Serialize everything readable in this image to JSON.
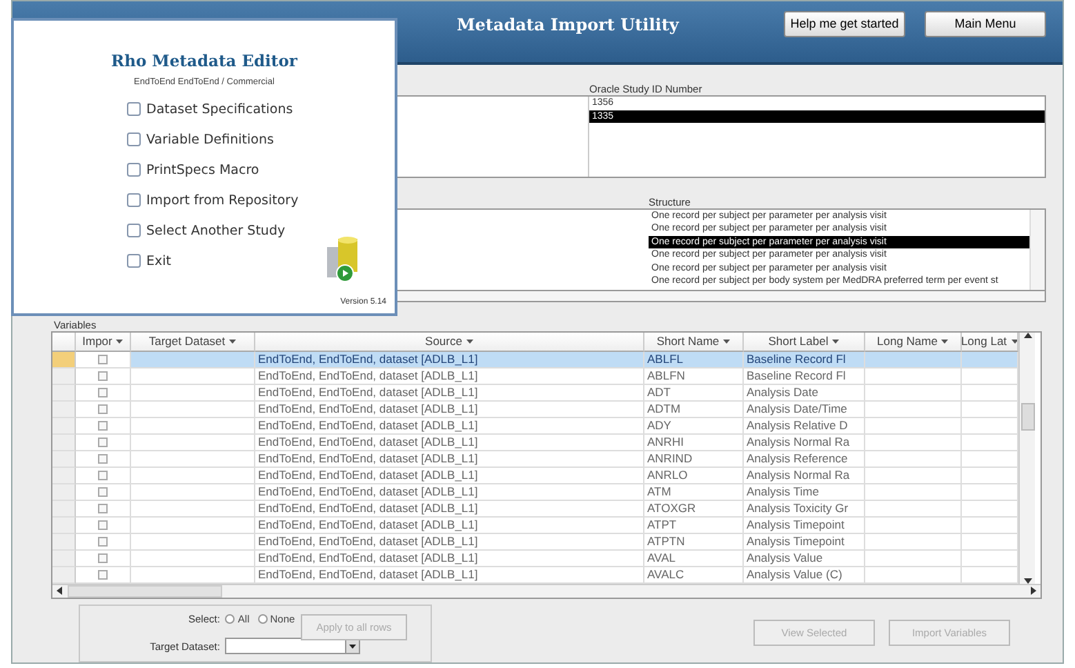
{
  "header": {
    "title": "Metadata Import Utility",
    "buttons": [
      "Help me get started",
      "Main Menu"
    ]
  },
  "study_list": {
    "column": "Oracle Study ID Number",
    "rows": [
      {
        "text": "1356",
        "selected": false
      },
      {
        "text": "1335",
        "selected": true
      }
    ]
  },
  "dataset_list": {
    "column": "Structure",
    "rows": [
      {
        "text": "One record per subject per parameter per analysis visit",
        "selected": false
      },
      {
        "text": "One record per subject per parameter per analysis visit",
        "selected": false
      },
      {
        "text": "One record per subject per parameter per analysis visit",
        "selected": true
      },
      {
        "text": "One record per subject per parameter per analysis visit",
        "selected": false
      },
      {
        "text": "One record per subject per parameter per analysis visit",
        "selected": false
      },
      {
        "text": "One record per subject per body system per MedDRA preferred term per event st",
        "selected": false
      }
    ]
  },
  "variables": {
    "label": "Variables",
    "columns": [
      "Impor",
      "Target Dataset",
      "Source",
      "Short Name",
      "Short Label",
      "Long Name",
      "Long Lat"
    ],
    "rows": [
      {
        "import": false,
        "selected": true,
        "source": "EndToEnd, EndToEnd, dataset [ADLB_L1]",
        "short_name": "ABLFL",
        "short_label": "Baseline Record Fl"
      },
      {
        "import": false,
        "selected": false,
        "source": "EndToEnd, EndToEnd, dataset [ADLB_L1]",
        "short_name": "ABLFN",
        "short_label": "Baseline Record Fl"
      },
      {
        "import": false,
        "selected": false,
        "source": "EndToEnd, EndToEnd, dataset [ADLB_L1]",
        "short_name": "ADT",
        "short_label": "Analysis Date"
      },
      {
        "import": false,
        "selected": false,
        "source": "EndToEnd, EndToEnd, dataset [ADLB_L1]",
        "short_name": "ADTM",
        "short_label": "Analysis Date/Time"
      },
      {
        "import": false,
        "selected": false,
        "source": "EndToEnd, EndToEnd, dataset [ADLB_L1]",
        "short_name": "ADY",
        "short_label": "Analysis Relative D"
      },
      {
        "import": false,
        "selected": false,
        "source": "EndToEnd, EndToEnd, dataset [ADLB_L1]",
        "short_name": "ANRHI",
        "short_label": "Analysis Normal Ra"
      },
      {
        "import": false,
        "selected": false,
        "source": "EndToEnd, EndToEnd, dataset [ADLB_L1]",
        "short_name": "ANRIND",
        "short_label": "Analysis Reference"
      },
      {
        "import": false,
        "selected": false,
        "source": "EndToEnd, EndToEnd, dataset [ADLB_L1]",
        "short_name": "ANRLO",
        "short_label": "Analysis Normal Ra"
      },
      {
        "import": false,
        "selected": false,
        "source": "EndToEnd, EndToEnd, dataset [ADLB_L1]",
        "short_name": "ATM",
        "short_label": "Analysis Time"
      },
      {
        "import": false,
        "selected": false,
        "source": "EndToEnd, EndToEnd, dataset [ADLB_L1]",
        "short_name": "ATOXGR",
        "short_label": "Analysis Toxicity Gr"
      },
      {
        "import": false,
        "selected": false,
        "source": "EndToEnd, EndToEnd, dataset [ADLB_L1]",
        "short_name": "ATPT",
        "short_label": "Analysis Timepoint"
      },
      {
        "import": false,
        "selected": false,
        "source": "EndToEnd, EndToEnd, dataset [ADLB_L1]",
        "short_name": "ATPTN",
        "short_label": "Analysis Timepoint"
      },
      {
        "import": false,
        "selected": false,
        "source": "EndToEnd, EndToEnd, dataset [ADLB_L1]",
        "short_name": "AVAL",
        "short_label": "Analysis Value"
      },
      {
        "import": false,
        "selected": false,
        "source": "EndToEnd, EndToEnd, dataset [ADLB_L1]",
        "short_name": "AVALC",
        "short_label": "Analysis Value (C)"
      }
    ]
  },
  "footer": {
    "select_label": "Select:",
    "radios": [
      {
        "label": "All",
        "selected": false
      },
      {
        "label": "None",
        "selected": false
      }
    ],
    "target_label": "Target Dataset:",
    "apply_button": {
      "label": "Apply to all rows",
      "disabled": true
    },
    "buttons": [
      {
        "label": "View Selected",
        "disabled": true
      },
      {
        "label": "Import Variables",
        "disabled": true
      }
    ]
  },
  "dialog": {
    "title": "Rho Metadata Editor",
    "subtitle": "EndToEnd EndToEnd / Commercial",
    "items": [
      {
        "label": "Dataset Specifications",
        "checked": false
      },
      {
        "label": "Variable Definitions",
        "checked": false
      },
      {
        "label": "PrintSpecs Macro",
        "checked": false
      },
      {
        "label": "Import from Repository",
        "checked": false
      },
      {
        "label": "Select Another Study",
        "checked": false
      },
      {
        "label": "Exit",
        "checked": false
      }
    ],
    "version": "Version 5.14"
  }
}
